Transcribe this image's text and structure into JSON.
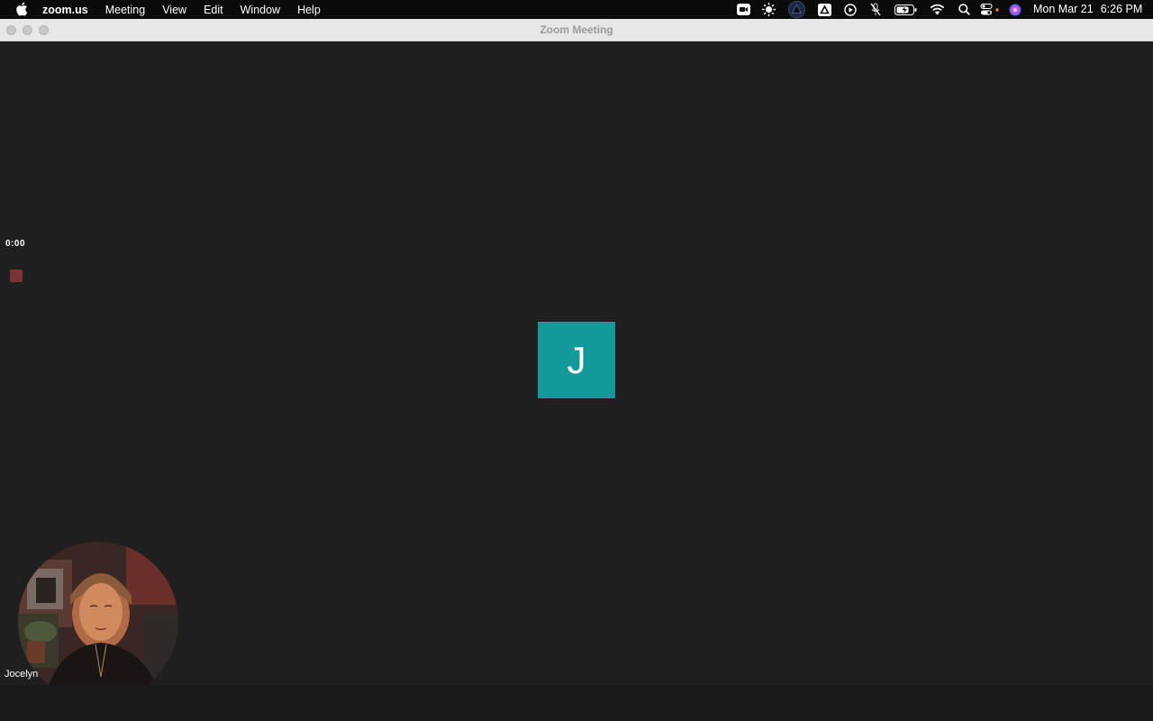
{
  "menubar": {
    "app_name": "zoom.us",
    "menus": [
      "Meeting",
      "View",
      "Edit",
      "Window",
      "Help"
    ],
    "status_icons": [
      "zoom-video-icon",
      "sun-icon",
      "triangle-circle-icon",
      "drive-icon",
      "play-circle-icon",
      "mic-off-icon",
      "battery-charging-icon",
      "wifi-icon",
      "search-icon",
      "control-center-icon",
      "siri-icon"
    ],
    "date": "Mon Mar 21",
    "time": "6:26 PM"
  },
  "window": {
    "title": "Zoom Meeting"
  },
  "meeting": {
    "timer": "0:00",
    "participant_initial": "J",
    "self_name": "Jocelyn"
  },
  "colors": {
    "avatar_bg": "#14999b",
    "stage_bg": "#1f1f1f",
    "record_indicator": "#7a3138"
  }
}
